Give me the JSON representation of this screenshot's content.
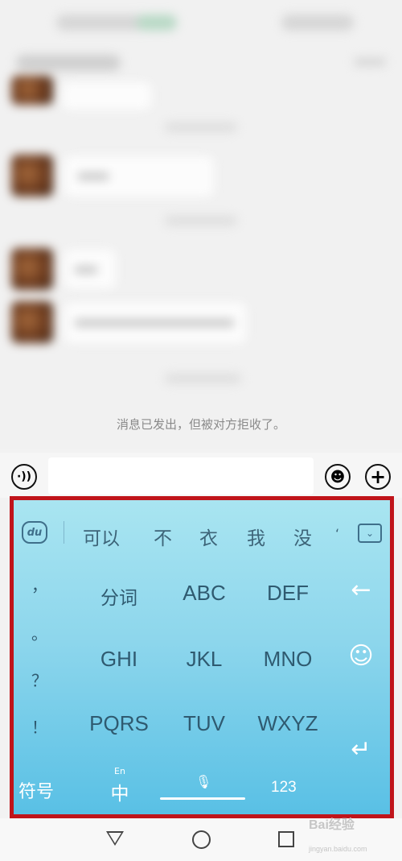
{
  "chat": {
    "notice": "消息已发出，但被对方拒收了。"
  },
  "input_row": {
    "voice_icon": "voice-icon",
    "emoji_icon": "emoji-icon",
    "plus_icon": "plus-icon",
    "voice_glyph": "·))",
    "emoji_glyph": "☻",
    "plus_glyph": "+"
  },
  "keyboard": {
    "logo": "du",
    "candidates": [
      "可以",
      "不",
      "衣",
      "我",
      "没",
      "‘"
    ],
    "collapse_glyph": "⌄",
    "punctuation": [
      "，",
      "。",
      "？",
      "！"
    ],
    "keys": [
      [
        "分词",
        "ABC",
        "DEF"
      ],
      [
        "GHI",
        "JKL",
        "MNO"
      ],
      [
        "PQRS",
        "TUV",
        "WXYZ"
      ]
    ],
    "side_keys": [
      "←",
      "☺",
      "↵"
    ],
    "symbol_key": "符号",
    "lang_en": "En",
    "lang_zh": "中",
    "number_key": "123",
    "mic_glyph": "🎙",
    "accent_color": "#c0141a"
  },
  "navbar": {
    "back_icon": "back-triangle-icon",
    "home_icon": "home-circle-icon",
    "recent_icon": "recent-square-icon"
  },
  "watermark": {
    "text": "Bai经验",
    "sub": "jingyan.baidu.com"
  }
}
